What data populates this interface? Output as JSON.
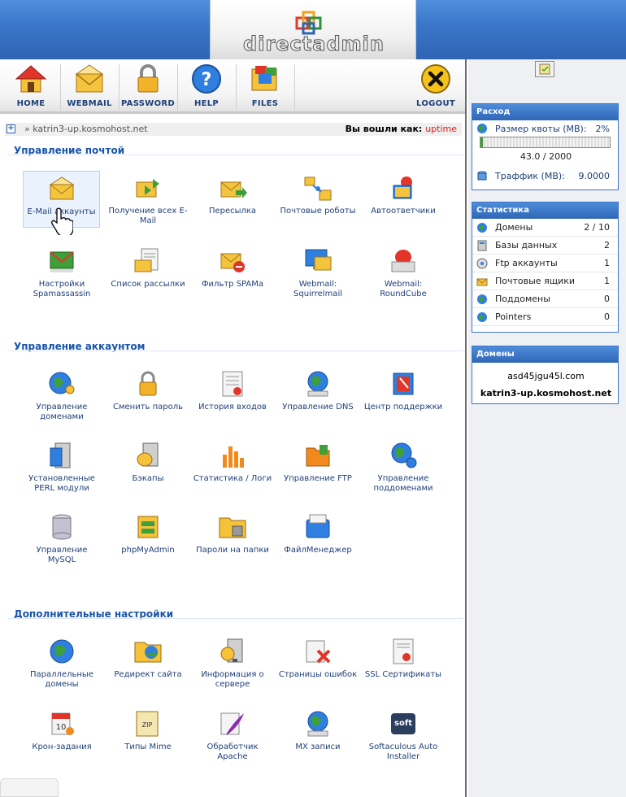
{
  "brand": {
    "logo_text": "directadmin",
    "colors": {
      "header_blue": "#3a75c9",
      "link_blue": "#1f3f77",
      "user_red": "#e21b1b"
    }
  },
  "toolbar": [
    {
      "label": "HOME",
      "icon": "house-icon"
    },
    {
      "label": "WEBMAIL",
      "icon": "envelope-icon"
    },
    {
      "label": "PASSWORD",
      "icon": "padlock-icon"
    },
    {
      "label": "HELP",
      "icon": "question-icon"
    },
    {
      "label": "FILES",
      "icon": "files-icon"
    },
    {
      "label": "LOGOUT",
      "icon": "logout-x-icon"
    }
  ],
  "breadcrumb": {
    "toggle": "+",
    "path": "» katrin3-up.kosmohost.net",
    "logged_as": "Вы вошли как:",
    "user": "uptime"
  },
  "sections": [
    {
      "title": "Управление почтой",
      "items": [
        "E-Mail аккаунты",
        "Получение всех E-Mail",
        "Пересылка",
        "Почтовые роботы",
        "Автоответчики",
        "Настройки Spamassassin",
        "Список рассылки",
        "Фильтр SPAMa",
        "Webmail: Squirrelmail",
        "Webmail: RoundCube"
      ]
    },
    {
      "title": "Управление аккаунтом",
      "items": [
        "Управление доменами",
        "Сменить пароль",
        "История входов",
        "Управление DNS",
        "Центр поддержки",
        "Установленные PERL модули",
        "Бэкапы",
        "Статистика / Логи",
        "Управление FTP",
        "Управление поддоменами",
        "Управление MySQL",
        "phpMyAdmin",
        "Пароли на папки",
        "ФайлМенеджер"
      ]
    },
    {
      "title": "Дополнительные настройки",
      "items": [
        "Параллельные домены",
        "Редирект сайта",
        "Информация о сервере",
        "Страницы ошибок",
        "SSL Сертификаты",
        "Крон-задания",
        "Типы Mime",
        "Обработчик Apache",
        "MX записи",
        "Softaculous Auto Installer"
      ]
    }
  ],
  "usage": {
    "title": "Расход",
    "quota_label": "Размер квоты (MB):",
    "quota_pct": "2%",
    "quota_fill": 0.02,
    "quota_value": "43.0 / 2000",
    "traffic_label": "Траффик (MB):",
    "traffic_value": "9.0000"
  },
  "stats": {
    "title": "Статистика",
    "rows": [
      {
        "label": "Домены",
        "value": "2 / 10",
        "icon": "globe-icon"
      },
      {
        "label": "Базы данных",
        "value": "2",
        "icon": "database-icon"
      },
      {
        "label": "Ftp аккаунты",
        "value": "1",
        "icon": "ftp-icon"
      },
      {
        "label": "Почтовые ящики",
        "value": "1",
        "icon": "mailbox-icon"
      },
      {
        "label": "Поддомены",
        "value": "0",
        "icon": "subdomain-icon"
      },
      {
        "label": "Pointers",
        "value": "0",
        "icon": "pointer-icon"
      }
    ]
  },
  "domains": {
    "title": "Домены",
    "list": [
      "asd45jgu45l.com",
      "katrin3-up.kosmohost.net"
    ]
  }
}
